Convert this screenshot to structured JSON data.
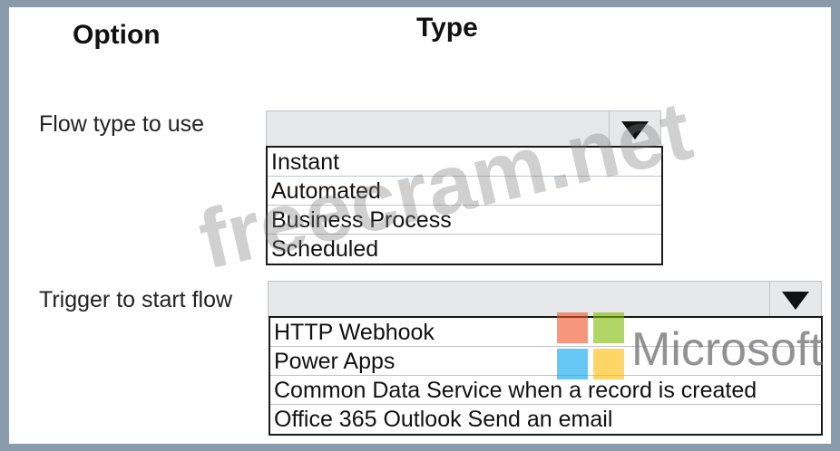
{
  "headers": {
    "option": "Option",
    "type": "Type"
  },
  "flow_type": {
    "label": "Flow type to use",
    "selected": "",
    "options": [
      "Instant",
      "Automated",
      "Business Process",
      "Scheduled"
    ]
  },
  "trigger": {
    "label": "Trigger to start flow",
    "selected": "",
    "options": [
      "HTTP Webhook",
      "Power Apps",
      "Common Data Service when a record is created",
      "Office 365 Outlook Send an email"
    ]
  },
  "watermark": {
    "text": "freecram.net"
  },
  "brand": {
    "text": "Microsoft",
    "logo_colors": [
      "#f25022",
      "#7fba00",
      "#00a4ef",
      "#ffb900"
    ]
  }
}
